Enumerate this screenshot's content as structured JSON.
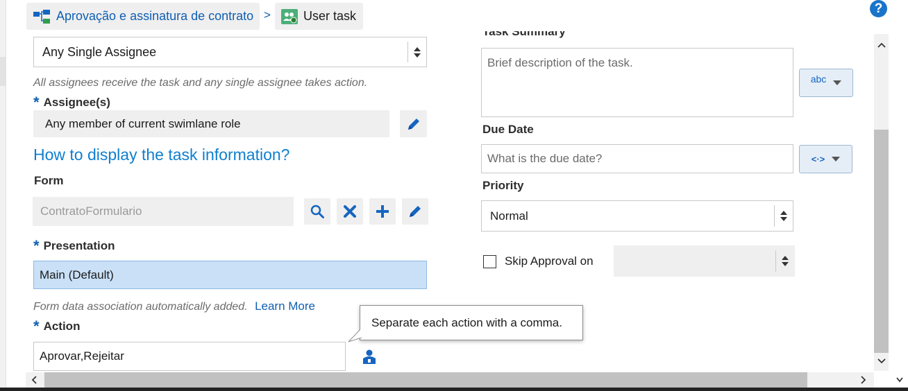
{
  "breadcrumb": {
    "process_label": "Aprovação e assinatura de contrato",
    "separator": ">",
    "task_label": "User task"
  },
  "help": {
    "label": "?"
  },
  "assignment": {
    "pattern_value": "Any Single Assignee",
    "pattern_hint": "All assignees receive the task and any single assignee takes action.",
    "assignees_label": "Assignee(s)",
    "assignees_value": "Any member of current swimlane role"
  },
  "display_section": {
    "title": "How to display the task information?"
  },
  "form": {
    "label": "Form",
    "value": "ContratoFormulario"
  },
  "presentation": {
    "label": "Presentation",
    "value": "Main (Default)",
    "hint": "Form data association automatically added.",
    "learn_more": "Learn More"
  },
  "action": {
    "label": "Action",
    "value": "Aprovar,Rejeitar",
    "tooltip": "Separate each action with a comma."
  },
  "task_summary": {
    "label": "Task Summary",
    "placeholder": "Brief description of the task.",
    "mode_button": "abc"
  },
  "due_date": {
    "label": "Due Date",
    "placeholder": "What is the due date?",
    "mode_button": "<·>"
  },
  "priority": {
    "label": "Priority",
    "value": "Normal"
  },
  "skip_approval": {
    "label": "Skip Approval on",
    "checked": false,
    "value": ""
  },
  "required_marker": "*",
  "colors": {
    "link_blue": "#0f5fb3",
    "section_blue": "#0f7fcf",
    "icon_blue": "#1565c0",
    "selected_bg": "#c9e0f7"
  }
}
